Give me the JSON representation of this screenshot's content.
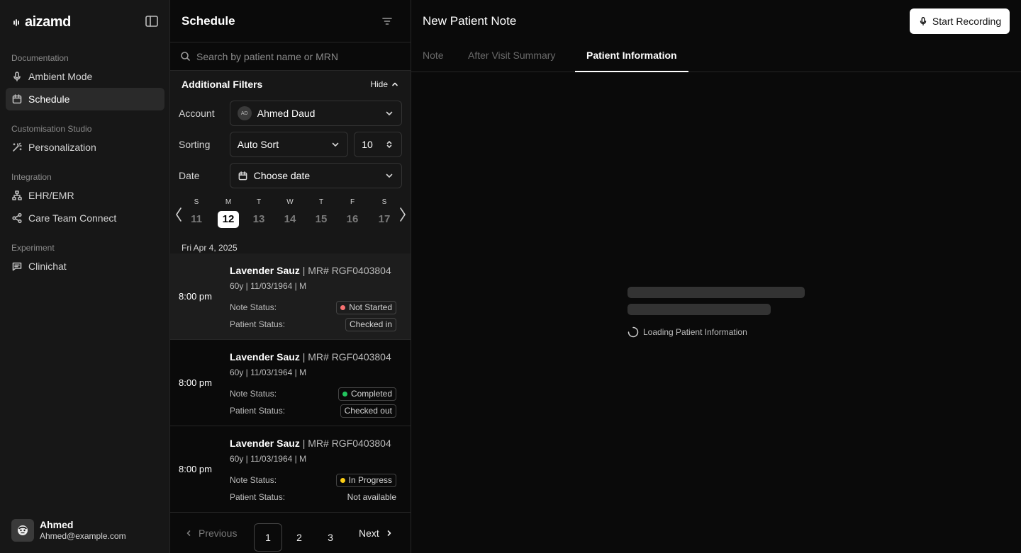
{
  "app": {
    "logo_text": "aizamd"
  },
  "sidebar": {
    "groups": [
      {
        "label": "Documentation",
        "items": [
          {
            "label": "Ambient Mode",
            "icon": "mic-icon"
          },
          {
            "label": "Schedule",
            "icon": "calendar-icon",
            "active": true
          }
        ]
      },
      {
        "label": "Customisation Studio",
        "items": [
          {
            "label": "Personalization",
            "icon": "wand-icon"
          }
        ]
      },
      {
        "label": "Integration",
        "items": [
          {
            "label": "EHR/EMR",
            "icon": "network-icon"
          },
          {
            "label": "Care Team Connect",
            "icon": "share-icon"
          }
        ]
      },
      {
        "label": "Experiment",
        "items": [
          {
            "label": "Clinichat",
            "icon": "chat-icon"
          }
        ]
      }
    ],
    "user": {
      "name": "Ahmed",
      "email": "Ahmed@example.com"
    }
  },
  "schedule": {
    "title": "Schedule",
    "search_placeholder": "Search by patient name or MRN",
    "filters": {
      "title": "Additional Filters",
      "hide_label": "Hide",
      "account_label": "Account",
      "account_initials": "AD",
      "account_value": "Ahmed Daud",
      "sorting_label": "Sorting",
      "sorting_value": "Auto Sort",
      "page_size": "10",
      "date_label": "Date",
      "date_placeholder": "Choose date"
    },
    "week": [
      {
        "letter": "S",
        "num": "11"
      },
      {
        "letter": "M",
        "num": "12",
        "active": true
      },
      {
        "letter": "T",
        "num": "13"
      },
      {
        "letter": "W",
        "num": "14"
      },
      {
        "letter": "T",
        "num": "15"
      },
      {
        "letter": "F",
        "num": "16"
      },
      {
        "letter": "S",
        "num": "17"
      }
    ],
    "date_header": "Fri Apr 4, 2025",
    "note_status_label": "Note Status:",
    "patient_status_label": "Patient Status:",
    "appointments": [
      {
        "time": "8:00 pm",
        "name": "Lavender Sauz",
        "mrn": " | MR# RGF0403804",
        "demo": "60y | 11/03/1964 | M",
        "note_status": "Not Started",
        "note_color": "#f87171",
        "patient_status": "Checked in",
        "selected": true
      },
      {
        "time": "8:00 pm",
        "name": "Lavender Sauz",
        "mrn": " | MR# RGF0403804",
        "demo": "60y | 11/03/1964 | M",
        "note_status": "Completed",
        "note_color": "#22c55e",
        "patient_status": "Checked out"
      },
      {
        "time": "8:00 pm",
        "name": "Lavender Sauz",
        "mrn": " | MR# RGF0403804",
        "demo": "60y | 11/03/1964 | M",
        "note_status": "In Progress",
        "note_color": "#facc15",
        "patient_status": "Not available"
      }
    ],
    "pagination": {
      "previous": "Previous",
      "next": "Next",
      "pages": [
        "1",
        "2",
        "3"
      ],
      "current": "1"
    }
  },
  "main": {
    "title": "New Patient Note",
    "record_label": "Start Recording",
    "tabs": [
      "Note",
      "After Visit Summary",
      "Patient Information"
    ],
    "active_tab": "Patient Information",
    "loading_text": "Loading Patient Information"
  }
}
